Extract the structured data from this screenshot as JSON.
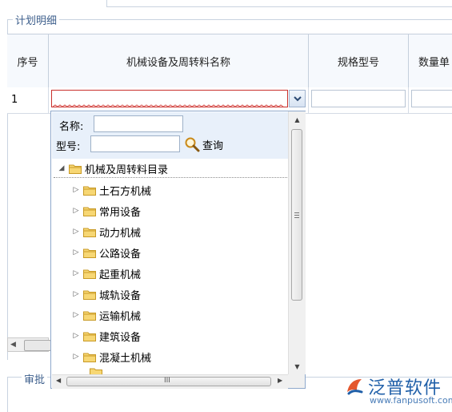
{
  "section": {
    "plan_details_title": "计划明细",
    "approval_title": "审批"
  },
  "table": {
    "columns": [
      "序号",
      "机械设备及周转料名称",
      "规格型号",
      "数量单"
    ],
    "rows": [
      {
        "index": "1",
        "name": "",
        "spec": "",
        "quantity": ""
      }
    ]
  },
  "dropdown": {
    "search": {
      "name_label": "名称:",
      "name_value": "",
      "model_label": "型号:",
      "model_value": "",
      "query_button": "查询"
    },
    "tree": {
      "root": {
        "label": "机械及周转料目录",
        "expanded": true
      },
      "children": [
        "土石方机械",
        "常用设备",
        "动力机械",
        "公路设备",
        "起重机械",
        "城轨设备",
        "运输机械",
        "建筑设备",
        "混凝土机械"
      ]
    },
    "scrollbar_grip_glyph": "III"
  },
  "icons": {
    "dropdown_arrow": "chevron-down-icon",
    "search": "magnifier-icon",
    "folder": "folder-icon",
    "expand": "triangle-right-icon",
    "collapse": "triangle-down-icon"
  },
  "colors": {
    "accent_blue": "#3d5f8c",
    "error_border": "#c9302c",
    "folder_yellow": "#f3c744"
  },
  "watermark": {
    "brand": "泛普软件",
    "url": "www.fanpusoft.com"
  }
}
